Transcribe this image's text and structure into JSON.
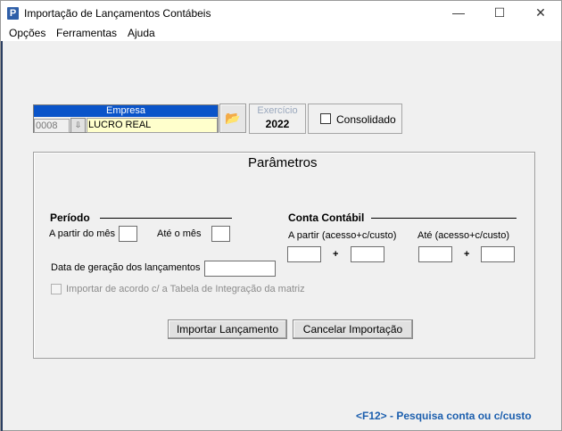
{
  "window": {
    "title": "Importação de Lançamentos Contábeis",
    "controls": {
      "minimize": "—",
      "maximize": "☐",
      "close": "✕"
    }
  },
  "menu": [
    {
      "label": "Opções"
    },
    {
      "label": "Ferramentas"
    },
    {
      "label": "Ajuda"
    }
  ],
  "empresa": {
    "header": "Empresa",
    "code": "0008",
    "name": "LUCRO REAL"
  },
  "exercicio": {
    "label": "Exercício",
    "value": "2022"
  },
  "consolidado": {
    "label": "Consolidado",
    "checked": false
  },
  "parametros": {
    "title": "Parâmetros",
    "periodo": {
      "title": "Período",
      "from_label": "A partir do mês",
      "from_value": "",
      "to_label": "Até o mês",
      "to_value": ""
    },
    "conta": {
      "title": "Conta Contábil",
      "from_label": "A partir (acesso+c/custo)",
      "to_label": "Até (acesso+c/custo)",
      "plus": "+"
    },
    "data_geracao_label": "Data de geração dos lançamentos",
    "importar_label": "Importar de acordo c/ a Tabela de Integração da matriz"
  },
  "buttons": {
    "importar": "Importar Lançamento",
    "cancelar": "Cancelar Importação"
  },
  "footer_hint": "<F12> - Pesquisa conta ou c/custo",
  "icons": {
    "app": "P",
    "folder": "📂",
    "lookup": "⇩"
  },
  "colors": {
    "header_blue": "#0a54c9",
    "hint_blue": "#1c5fae",
    "name_bg": "#ffffcc"
  }
}
